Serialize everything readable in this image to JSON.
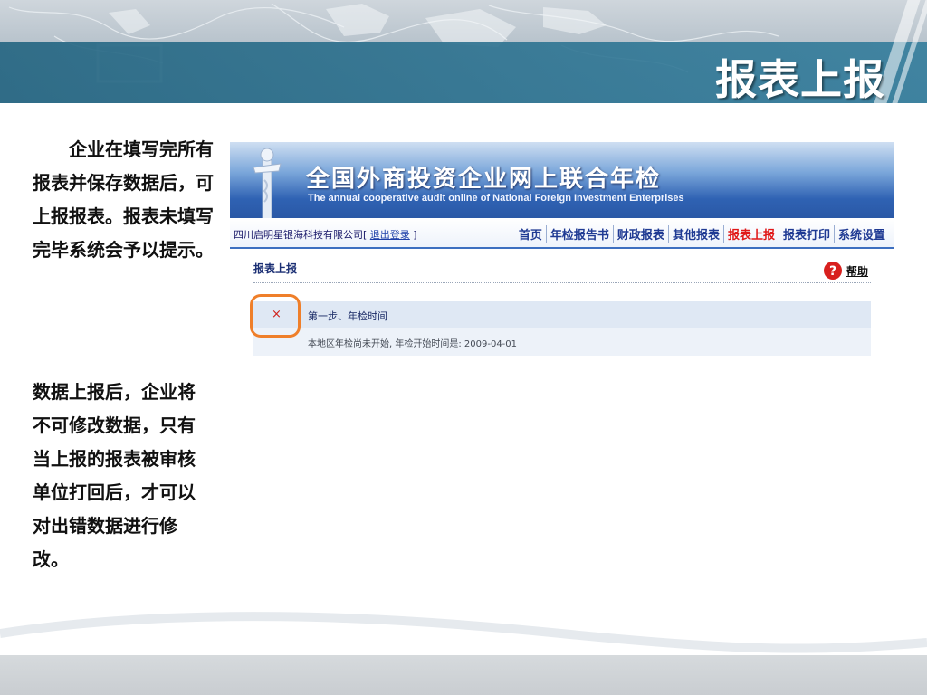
{
  "slide": {
    "title": "报表上报",
    "note_1": "企业在填写完所有报表并保存数据后，可上报报表。报表未填写完毕系统会予以提示。",
    "note_2": "数据上报后，企业将不可修改数据，只有当上报的报表被审核单位打回后，才可以对出错数据进行修改。"
  },
  "screenshot": {
    "header": {
      "title": "全国外商投资企业网上联合年检",
      "subtitle": "The annual cooperative audit online  of National Foreign Investment Enterprises"
    },
    "company": {
      "name": "四川启明星银海科技有限公司",
      "bracket_open": "[",
      "logout_label": "退出登录",
      "bracket_close": "]"
    },
    "nav": [
      {
        "label": "首页"
      },
      {
        "label": "年检报告书"
      },
      {
        "label": "财政报表"
      },
      {
        "label": "其他报表"
      },
      {
        "label": "报表上报",
        "active": true
      },
      {
        "label": "报表打印"
      },
      {
        "label": "系统设置"
      }
    ],
    "section_title": "报表上报",
    "help_label": "帮助",
    "step": {
      "status_icon": "×",
      "title": "第一步、年检时间",
      "info": "本地区年检尚未开始, 年检开始时间是: 2009-04-01"
    }
  },
  "colors": {
    "banner_bar": "#2e7492",
    "highlight": "#ef7f2a",
    "nav_active": "#e01818",
    "header_blue": "#2f62b3"
  }
}
